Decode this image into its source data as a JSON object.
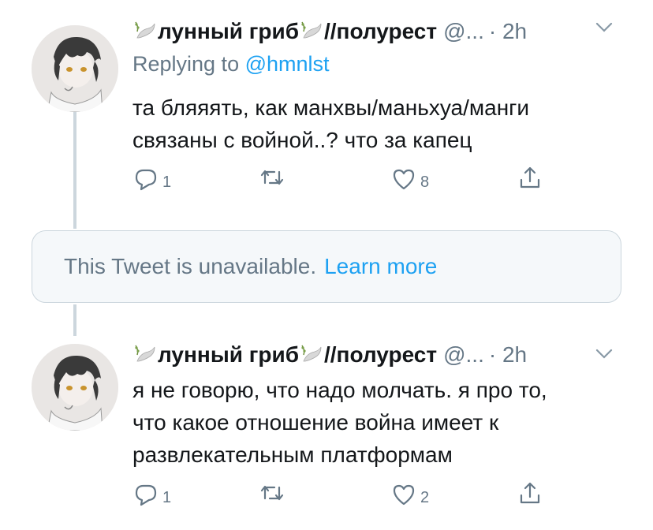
{
  "tweets": [
    {
      "name": "лунный гриб",
      "separator": "//полурест",
      "handle": "@...",
      "time": "· 2h",
      "replying_label": "Replying to",
      "replying_mention": "@hmnlst",
      "text_lines": [
        "та бляяять, как манхвы/маньхуа/манги",
        "связаны с войной..? что за капец"
      ],
      "replies": "1",
      "retweets": "",
      "likes": "8"
    },
    {
      "name": "лунный гриб",
      "separator": "//полурест",
      "handle": "@...",
      "time": "· 2h",
      "text_lines": [
        "я не говорю, что надо молчать. я про то,",
        "что какое отношение война имеет к",
        "развлекательным платформам"
      ],
      "replies": "1",
      "retweets": "",
      "likes": "2"
    }
  ],
  "unavailable": {
    "message": "This Tweet is unavailable.",
    "link": "Learn more"
  },
  "colors": {
    "text": "#14171a",
    "secondary": "#657786",
    "link": "#1da1f2",
    "border": "#ccd6dd",
    "card_bg": "#f5f8fa"
  },
  "icons": [
    "dove-icon",
    "chevron-down-icon",
    "reply-icon",
    "retweet-icon",
    "like-icon",
    "share-icon"
  ]
}
